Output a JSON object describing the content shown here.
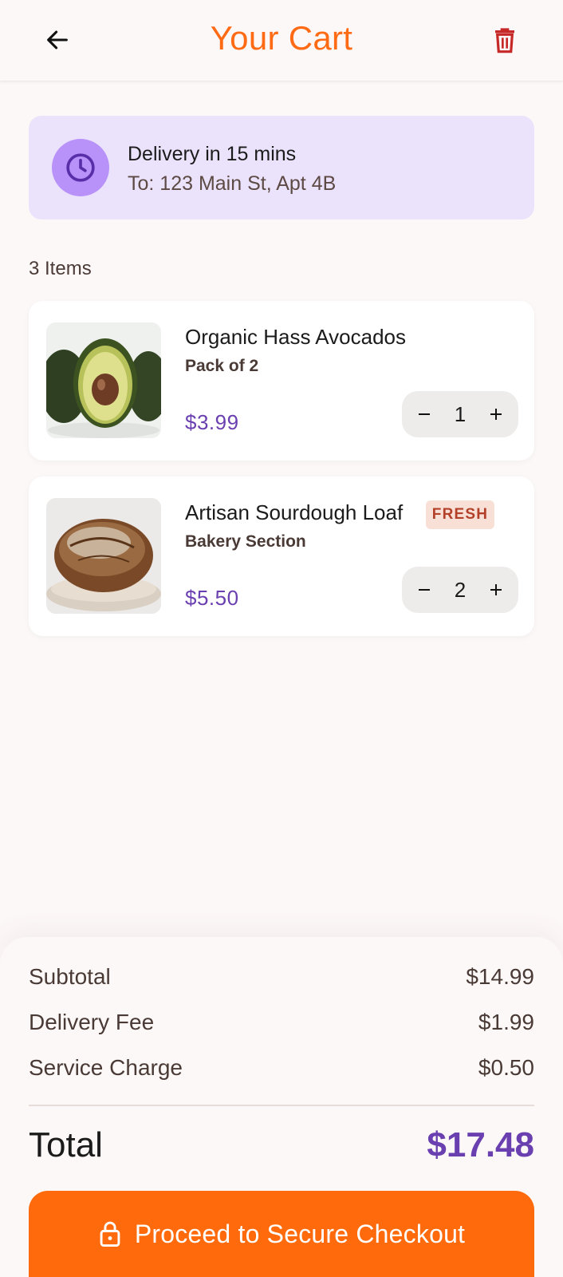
{
  "header": {
    "title": "Your Cart"
  },
  "delivery": {
    "title": "Delivery in 15 mins",
    "address": "To: 123 Main St, Apt 4B"
  },
  "cart": {
    "count_label": "3 Items",
    "items": [
      {
        "name": "Organic Hass Avocados",
        "subtitle": "Pack of 2",
        "price": "$3.99",
        "quantity": "1",
        "badge": ""
      },
      {
        "name": "Artisan Sourdough Loaf",
        "subtitle": "Bakery Section",
        "price": "$5.50",
        "quantity": "2",
        "badge": "FRESH"
      }
    ]
  },
  "summary": {
    "subtotal_label": "Subtotal",
    "subtotal_value": "$14.99",
    "delivery_fee_label": "Delivery Fee",
    "delivery_fee_value": "$1.99",
    "service_charge_label": "Service Charge",
    "service_charge_value": "$0.50",
    "total_label": "Total",
    "total_value": "$17.48"
  },
  "checkout": {
    "label": "Proceed to Secure Checkout"
  },
  "icons": {
    "back": "arrow-left-icon",
    "trash": "trash-icon",
    "clock": "clock-icon",
    "lock": "lock-icon"
  },
  "colors": {
    "accent": "#ff6a14",
    "price": "#6a3fb0",
    "trash": "#c62828",
    "delivery_bg": "#ebe3fb"
  }
}
